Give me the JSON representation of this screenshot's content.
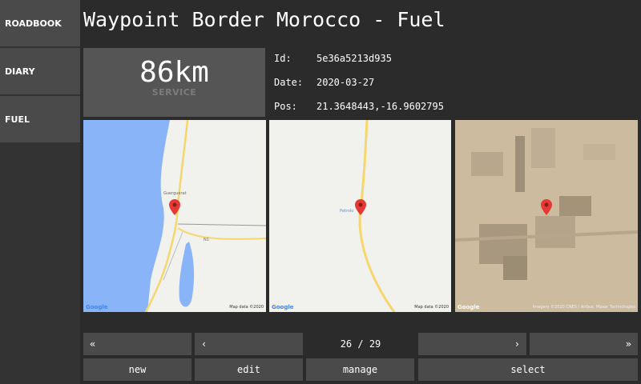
{
  "sidebar": {
    "items": [
      {
        "label": "ROADBOOK"
      },
      {
        "label": "DIARY"
      },
      {
        "label": "FUEL"
      }
    ]
  },
  "header": {
    "title": "Waypoint Border Morocco - Fuel"
  },
  "distance": {
    "value": "86km",
    "label": "SERVICE"
  },
  "info": {
    "id_label": "Id:",
    "id_value": "5e36a5213d935",
    "date_label": "Date:",
    "date_value": "2020-03-27",
    "pos_label": "Pos:",
    "pos_value": "21.3648443,-16.9602795"
  },
  "maps": [
    {
      "google": "Google",
      "attribution": "Map data ©2020",
      "place": "Guerguerat",
      "road": "N1"
    },
    {
      "google": "Google",
      "attribution": "Map data ©2020",
      "place": "Petrolo"
    },
    {
      "google": "Google",
      "attribution": "Imagery ©2020 CNES / Airbus, Maxar Technologies"
    }
  ],
  "nav": {
    "first": "«",
    "prev": "‹",
    "page": "26 / 29",
    "next": "›",
    "last": "»"
  },
  "actions": {
    "new": "new",
    "edit": "edit",
    "manage": "manage",
    "select": "select"
  },
  "colors": {
    "background": "#2b2b2b",
    "button": "#4a4a4a",
    "panel": "#555555",
    "sidebar": "#333333",
    "marker": "#e53935"
  }
}
